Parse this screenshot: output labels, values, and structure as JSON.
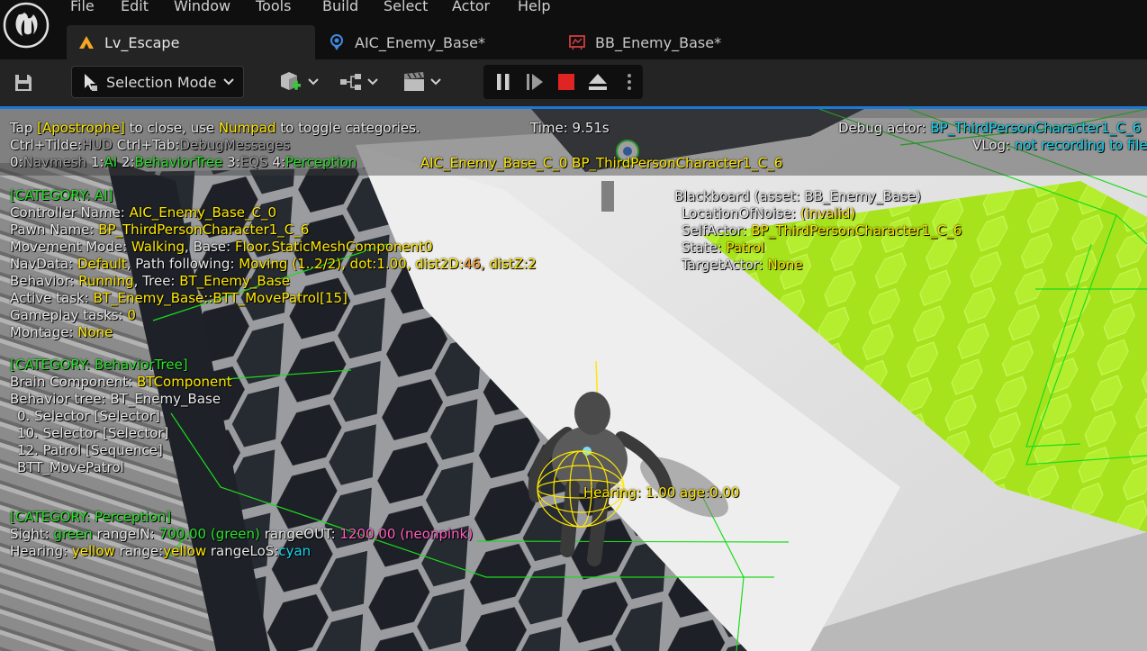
{
  "menu": [
    "File",
    "Edit",
    "Window",
    "Tools",
    "Build",
    "Select",
    "Actor",
    "Help"
  ],
  "tabs": [
    {
      "label": "Lv_Escape",
      "icon": "level-icon",
      "active": true
    },
    {
      "label": "AIC_Enemy_Base*",
      "icon": "ai-controller-icon",
      "active": false
    },
    {
      "label": "BB_Enemy_Base*",
      "icon": "blackboard-icon",
      "active": false
    }
  ],
  "toolbar": {
    "selection_mode_label": "Selection Mode"
  },
  "debug": {
    "tap_prefix": "Tap ",
    "tap_key": "[Apostrophe]",
    "tap_middle": " to close, use ",
    "tap_numpad": "Numpad",
    "tap_suffix": " to toggle categories.",
    "time_label": "Time: 9.51s",
    "debug_actor_label": "Debug actor: ",
    "debug_actor_value": "BP_ThirdPersonCharacter1_C_6",
    "vlog_label": "VLog: ",
    "vlog_value": "not recording to file",
    "ctrl_tilde": "Ctrl+Tilde:",
    "ctrl_tilde_value": "HUD",
    "ctrl_tab": "Ctrl+Tab:",
    "ctrl_tab_value": "DebugMessages",
    "cat0_key": "0:",
    "cat0": "Navmesh",
    "cat1_key": "1:",
    "cat1": "AI",
    "cat2_key": "2:",
    "cat2": "BehaviorTree",
    "cat3_key": "3:",
    "cat3": "EQS",
    "cat4_key": "4:",
    "cat4": "Perception",
    "actor_line": "AIC_Enemy_Base_C_0 BP_ThirdPersonCharacter1_C_6",
    "ai": {
      "header": "[CATEGORY: AI]",
      "controller_label": "Controller Name: ",
      "controller_value": "AIC_Enemy_Base_C_0",
      "pawn_label": "Pawn Name: ",
      "pawn_value": "BP_ThirdPersonCharacter1_C_6",
      "movement_label": "Movement Mode: ",
      "movement_value": "Walking",
      "base_label": ", Base: ",
      "base_value": "Floor.StaticMeshComponent0",
      "navdata_label": "NavData: ",
      "navdata_value": "Default",
      "path_label": ", Path following: ",
      "path_value": "Moving (1..2/2), dot:1.00, dist2D:",
      "path_dist2d": "46",
      "path_distz_sep": ", ",
      "path_distz": "distZ:2",
      "behavior_label": "Behavior: ",
      "behavior_value": "Running",
      "tree_label": ", Tree: ",
      "tree_value": "BT_Enemy_Base",
      "task_label": "Active task: ",
      "task_value": "BT_Enemy_Base::BTT_MovePatrol[15]",
      "gameplay_label": "Gameplay tasks: ",
      "gameplay_value": "0",
      "montage_label": "Montage: ",
      "montage_value": "None"
    },
    "bt": {
      "header": "[CATEGORY: BehaviorTree]",
      "brain_label": "Brain Component: ",
      "brain_value": "BTComponent",
      "tree_line": "Behavior tree: BT_Enemy_Base",
      "nodes": [
        "0. Selector [Selector]",
        "10. Selector [Selector]",
        "12. Patrol [Sequence]",
        "BTT_MovePatrol"
      ]
    },
    "perception": {
      "header": "[CATEGORY: Perception]",
      "sight_label": "Sight: ",
      "sight_value": "green",
      "rangein_label": " rangeIN: ",
      "rangein_value": "700.00 (green)",
      "rangeout_label": " rangeOUT: ",
      "rangeout_value": "1200.00 (neonpink)",
      "hearing_label": "Hearing: ",
      "hearing_value": "yellow",
      "range_label": " range:",
      "range_value": "yellow",
      "rangelos_label": " rangeLoS:",
      "rangelos_value": "cyan"
    },
    "blackboard": {
      "header": "Blackboard (asset: BB_Enemy_Base)",
      "location_label": "LocationOfNoise: ",
      "location_value": "(invalid)",
      "self_label": "SelfActor: ",
      "self_value": "BP_ThirdPersonCharacter1_C_6",
      "state_label": "State: ",
      "state_value": "Patrol",
      "target_label": "TargetActor: ",
      "target_value": "None"
    },
    "hearing_tag": "Hearing: 1.00 age:0.00"
  },
  "colors": {
    "accent_blue": "#1b78d6",
    "debug_yellow": "#ffe800",
    "debug_green": "#2ce12c",
    "debug_cyan": "#16d6f0",
    "debug_pink": "#ff5fc1",
    "debug_orange": "#ffa52e",
    "stop_red": "#e02323"
  }
}
